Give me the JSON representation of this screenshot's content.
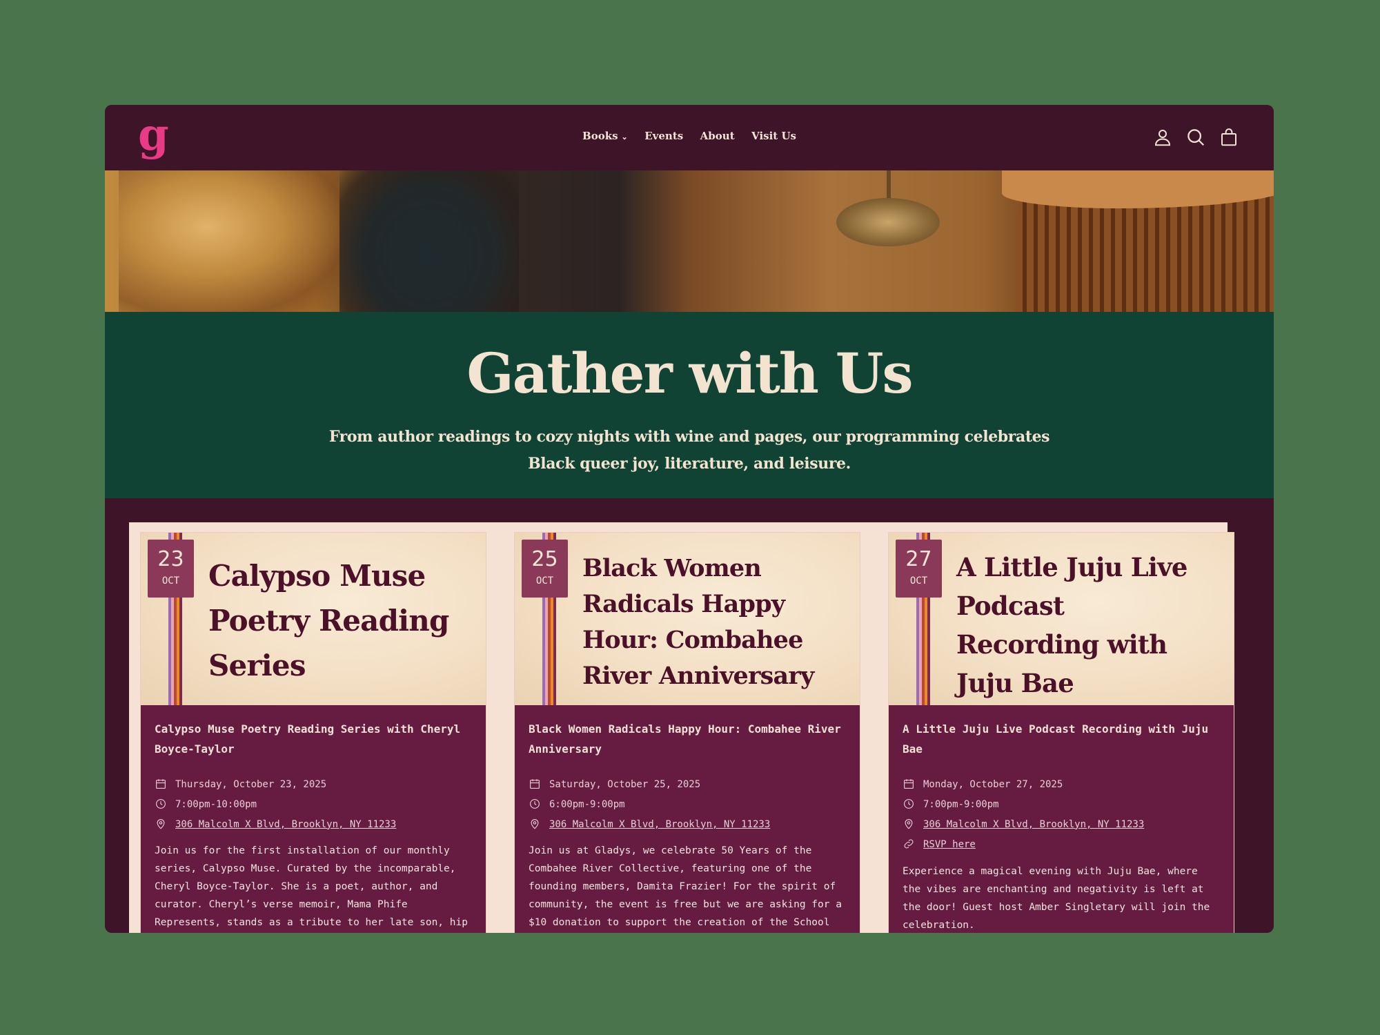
{
  "header": {
    "logo": "g",
    "nav": [
      {
        "label": "Books",
        "has_dropdown": true
      },
      {
        "label": "Events",
        "has_dropdown": false
      },
      {
        "label": "About",
        "has_dropdown": false
      },
      {
        "label": "Visit Us",
        "has_dropdown": false
      }
    ],
    "icons": [
      "account-icon",
      "search-icon",
      "cart-icon"
    ]
  },
  "hero": {
    "title": "Gather with Us",
    "subtitle": "From author readings to cozy nights with wine and pages, our programming celebrates Black queer joy, literature, and leisure."
  },
  "events": [
    {
      "day": "23",
      "month": "OCT",
      "card_title": "Calypso Muse Poetry Reading Series",
      "heading": "Calypso Muse Poetry Reading Series with Cheryl Boyce-Taylor",
      "date": "Thursday, October 23, 2025",
      "time": "7:00pm-10:00pm",
      "address": "306 Malcolm X Blvd, Brooklyn, NY 11233",
      "rsvp": "",
      "description": "Join us for the first installation of our monthly series, Calypso Muse. Curated by the incomparable, Cheryl Boyce-Taylor. She is a poet, author, and curator. Cheryl’s verse memoir, Mama Phife Represents, stands as a tribute to her late son, hip"
    },
    {
      "day": "25",
      "month": "OCT",
      "card_title": "Black Women Radicals Happy Hour: Combahee River Anniversary",
      "heading": "Black Women Radicals Happy Hour: Combahee River Anniversary",
      "date": "Saturday, October 25, 2025",
      "time": "6:00pm-9:00pm",
      "address": "306 Malcolm X Blvd, Brooklyn, NY 11233",
      "rsvp": "",
      "description": "Join us at Gladys, we celebrate 50 Years of the Combahee River Collective, featuring one of the founding members, Damita Frazier! For the spirit of community, the event is free but we are asking for a $10 donation to support the creation of the School"
    },
    {
      "day": "27",
      "month": "OCT",
      "card_title": "A Little Juju Live Podcast Recording with Juju Bae",
      "heading": "A Little Juju Live Podcast Recording with Juju Bae",
      "date": "Monday, October 27, 2025",
      "time": "7:00pm-9:00pm",
      "address": "306 Malcolm X Blvd, Brooklyn, NY 11233",
      "rsvp": "RSVP here",
      "description": "Experience a magical evening with Juju Bae, where the vibes are enchanting and negativity is left at the door! Guest host Amber Singletary will join the celebration."
    }
  ],
  "colors": {
    "page_bg": "#4a744c",
    "header_bg": "#3e1429",
    "logo": "#e93a86",
    "band": "#114334",
    "cream": "#f3e4d2",
    "card_body": "#651c40",
    "date_badge": "#8a3a58",
    "card_title": "#4a1128"
  }
}
